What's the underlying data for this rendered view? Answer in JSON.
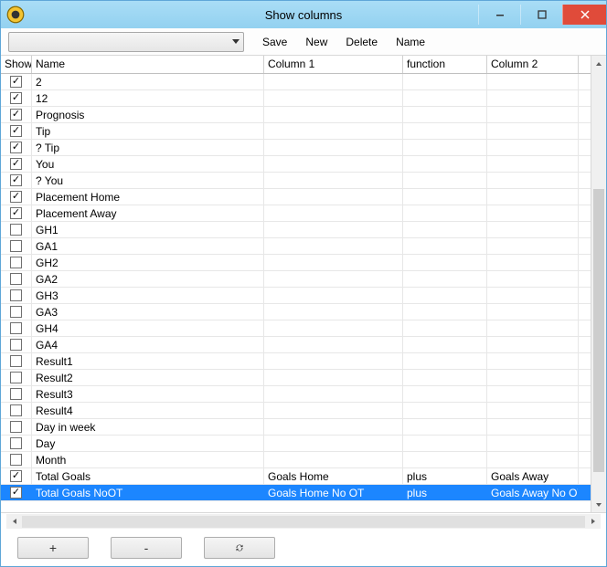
{
  "window": {
    "title": "Show columns"
  },
  "toolbar": {
    "save": "Save",
    "new": "New",
    "delete": "Delete",
    "name": "Name"
  },
  "headers": {
    "show": "Show",
    "name": "Name",
    "col1": "Column 1",
    "fn": "function",
    "col2": "Column 2"
  },
  "buttons": {
    "plus": "+",
    "minus": "-"
  },
  "rows": [
    {
      "show": true,
      "name": "2",
      "c1": "",
      "fn": "",
      "c2": "",
      "selected": false,
      "dd": false
    },
    {
      "show": true,
      "name": "12",
      "c1": "",
      "fn": "",
      "c2": "",
      "selected": false,
      "dd": false
    },
    {
      "show": true,
      "name": "Prognosis",
      "c1": "",
      "fn": "",
      "c2": "",
      "selected": false,
      "dd": false
    },
    {
      "show": true,
      "name": "Tip",
      "c1": "",
      "fn": "",
      "c2": "",
      "selected": false,
      "dd": false
    },
    {
      "show": true,
      "name": "? Tip",
      "c1": "",
      "fn": "",
      "c2": "",
      "selected": false,
      "dd": false
    },
    {
      "show": true,
      "name": "You",
      "c1": "",
      "fn": "",
      "c2": "",
      "selected": false,
      "dd": false
    },
    {
      "show": true,
      "name": "? You",
      "c1": "",
      "fn": "",
      "c2": "",
      "selected": false,
      "dd": false
    },
    {
      "show": true,
      "name": "Placement Home",
      "c1": "",
      "fn": "",
      "c2": "",
      "selected": false,
      "dd": false
    },
    {
      "show": true,
      "name": "Placement Away",
      "c1": "",
      "fn": "",
      "c2": "",
      "selected": false,
      "dd": false
    },
    {
      "show": false,
      "name": "GH1",
      "c1": "",
      "fn": "",
      "c2": "",
      "selected": false,
      "dd": false
    },
    {
      "show": false,
      "name": "GA1",
      "c1": "",
      "fn": "",
      "c2": "",
      "selected": false,
      "dd": false
    },
    {
      "show": false,
      "name": "GH2",
      "c1": "",
      "fn": "",
      "c2": "",
      "selected": false,
      "dd": false
    },
    {
      "show": false,
      "name": "GA2",
      "c1": "",
      "fn": "",
      "c2": "",
      "selected": false,
      "dd": false
    },
    {
      "show": false,
      "name": "GH3",
      "c1": "",
      "fn": "",
      "c2": "",
      "selected": false,
      "dd": false
    },
    {
      "show": false,
      "name": "GA3",
      "c1": "",
      "fn": "",
      "c2": "",
      "selected": false,
      "dd": false
    },
    {
      "show": false,
      "name": "GH4",
      "c1": "",
      "fn": "",
      "c2": "",
      "selected": false,
      "dd": false
    },
    {
      "show": false,
      "name": "GA4",
      "c1": "",
      "fn": "",
      "c2": "",
      "selected": false,
      "dd": false
    },
    {
      "show": false,
      "name": "Result1",
      "c1": "",
      "fn": "",
      "c2": "",
      "selected": false,
      "dd": false
    },
    {
      "show": false,
      "name": "Result2",
      "c1": "",
      "fn": "",
      "c2": "",
      "selected": false,
      "dd": false
    },
    {
      "show": false,
      "name": "Result3",
      "c1": "",
      "fn": "",
      "c2": "",
      "selected": false,
      "dd": false
    },
    {
      "show": false,
      "name": "Result4",
      "c1": "",
      "fn": "",
      "c2": "",
      "selected": false,
      "dd": false
    },
    {
      "show": false,
      "name": "Day in week",
      "c1": "",
      "fn": "",
      "c2": "",
      "selected": false,
      "dd": false
    },
    {
      "show": false,
      "name": "Day",
      "c1": "",
      "fn": "",
      "c2": "",
      "selected": false,
      "dd": false
    },
    {
      "show": false,
      "name": "Month",
      "c1": "",
      "fn": "",
      "c2": "",
      "selected": false,
      "dd": false
    },
    {
      "show": true,
      "name": "Total Goals",
      "c1": "Goals Home",
      "fn": "plus",
      "c2": "Goals Away",
      "selected": false,
      "dd": false
    },
    {
      "show": true,
      "name": "Total Goals NoOT",
      "c1": "Goals Home No OT",
      "fn": "plus",
      "c2": "Goals Away No OT",
      "selected": true,
      "dd": true
    }
  ]
}
